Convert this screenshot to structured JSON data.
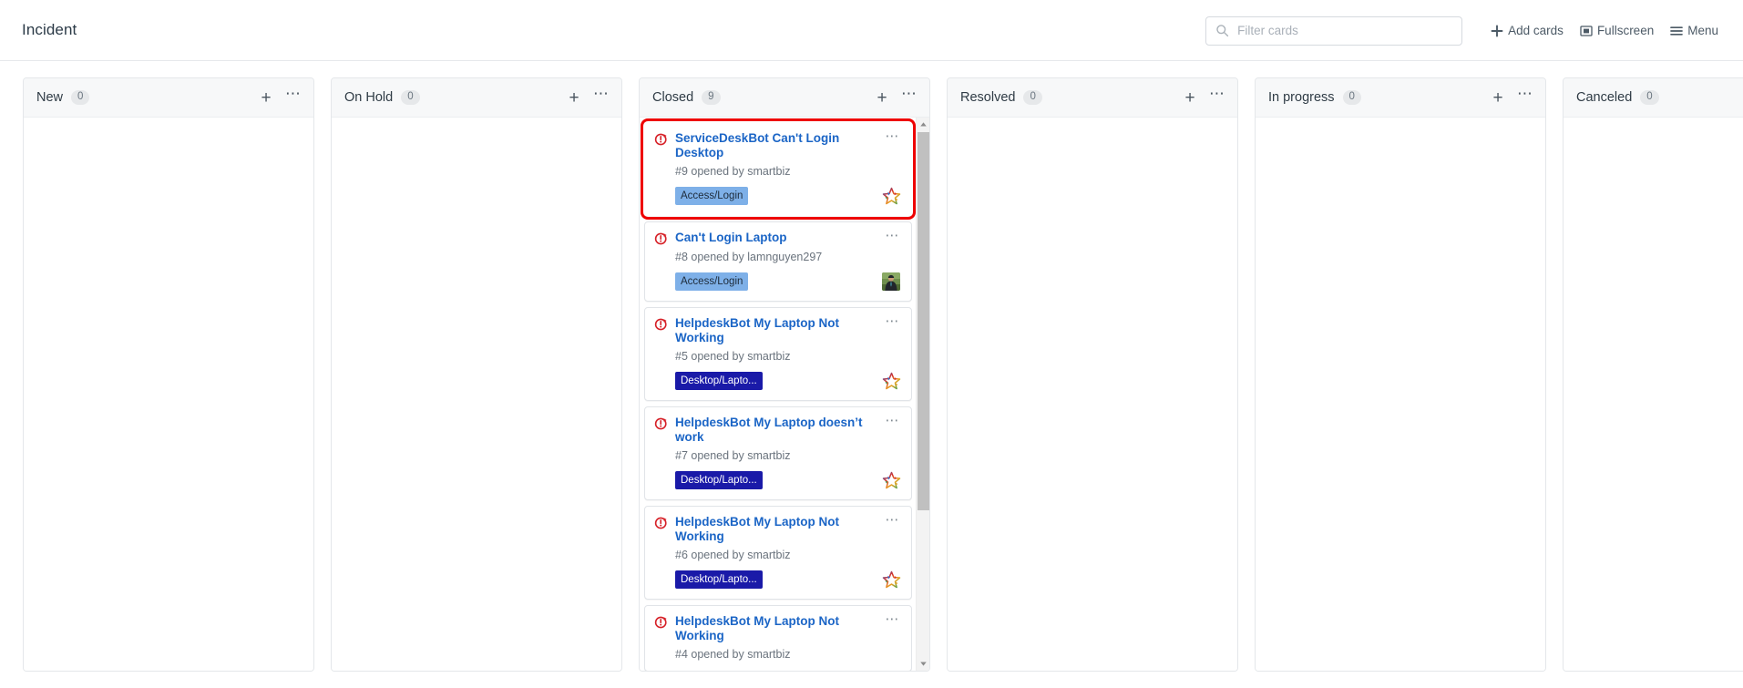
{
  "header": {
    "title": "Incident",
    "search": {
      "placeholder": "Filter cards",
      "value": "",
      "icon": "search-icon"
    },
    "actions": [
      {
        "label": "Add cards",
        "icon": "plus-icon",
        "name": "add-cards-button"
      },
      {
        "label": "Fullscreen",
        "icon": "fullscreen-icon",
        "name": "fullscreen-button"
      },
      {
        "label": "Menu",
        "icon": "hamburger-menu-icon",
        "name": "menu-button"
      }
    ]
  },
  "colors": {
    "accent_link": "#1b65c6",
    "selection_highlight": "#ee0000",
    "incident_icon": "#d62027",
    "label_access_login_bg": "#7eb0e8",
    "label_access_login_text": "#1d2b3a",
    "label_desktop_bg": "#1a1aa8",
    "label_desktop_text": "#ffffff",
    "column_bg": "#f7f8f9",
    "card_border": "#e1e4e8"
  },
  "board": {
    "columns": [
      {
        "name": "New",
        "count": "0",
        "add_label": "+",
        "more_label": "⋯",
        "cards": []
      },
      {
        "name": "On Hold",
        "count": "0",
        "add_label": "+",
        "more_label": "⋯",
        "cards": []
      },
      {
        "name": "Closed",
        "count": "9",
        "add_label": "+",
        "more_label": "⋯",
        "has_scrollbar": true,
        "cards": [
          {
            "title": "ServiceDeskBot Can't Login Desktop",
            "meta": "#9 opened by smartbiz",
            "label": "Access/Login",
            "label_style": "blue-light",
            "avatar": "bot-star-avatar",
            "selected": true,
            "icon": "incident-open-icon",
            "menu": "⋯"
          },
          {
            "title": "Can't Login Laptop",
            "meta": "#8 opened by lamnguyen297",
            "label": "Access/Login",
            "label_style": "blue-light",
            "avatar": "user-photo-avatar",
            "selected": false,
            "icon": "incident-open-icon",
            "menu": "⋯"
          },
          {
            "title": "HelpdeskBot My Laptop Not Working",
            "meta": "#5 opened by smartbiz",
            "label": "Desktop/Lapto...",
            "label_style": "blue-dark",
            "avatar": "bot-star-avatar",
            "selected": false,
            "icon": "incident-open-icon",
            "menu": "⋯"
          },
          {
            "title": "HelpdeskBot My Laptop doesn’t work",
            "meta": "#7 opened by smartbiz",
            "label": "Desktop/Lapto...",
            "label_style": "blue-dark",
            "avatar": "bot-star-avatar",
            "selected": false,
            "icon": "incident-open-icon",
            "menu": "⋯"
          },
          {
            "title": "HelpdeskBot My Laptop Not Working",
            "meta": "#6 opened by smartbiz",
            "label": "Desktop/Lapto...",
            "label_style": "blue-dark",
            "avatar": "bot-star-avatar",
            "selected": false,
            "icon": "incident-open-icon",
            "menu": "⋯"
          },
          {
            "title": "HelpdeskBot My Laptop Not Working",
            "meta": "#4 opened by smartbiz",
            "label": "",
            "label_style": "none",
            "avatar": "",
            "selected": false,
            "icon": "incident-open-icon",
            "menu": "⋯"
          }
        ]
      },
      {
        "name": "Resolved",
        "count": "0",
        "add_label": "+",
        "more_label": "⋯",
        "cards": []
      },
      {
        "name": "In progress",
        "count": "0",
        "add_label": "+",
        "more_label": "⋯",
        "cards": []
      },
      {
        "name": "Canceled",
        "count": "0",
        "add_label": "+",
        "more_label": "⋯",
        "cards": []
      }
    ]
  }
}
